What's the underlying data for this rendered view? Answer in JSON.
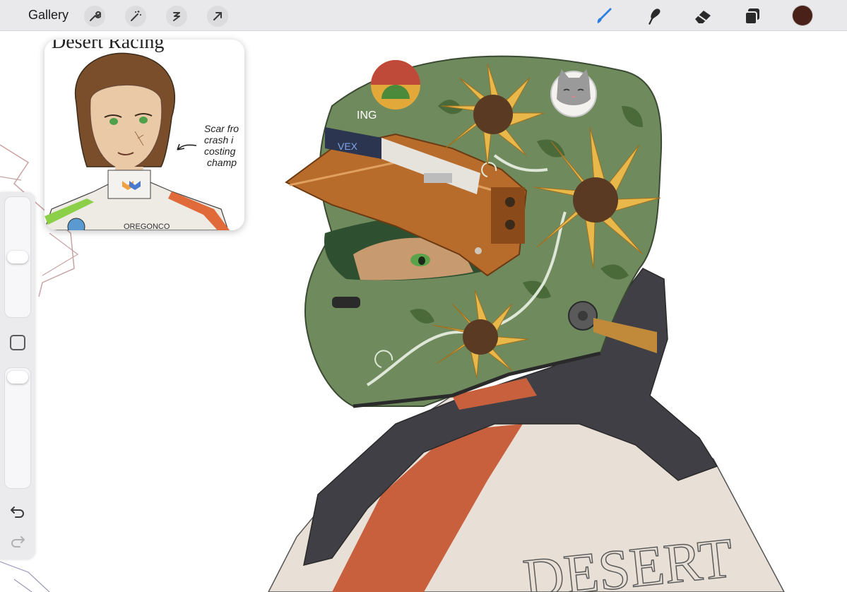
{
  "app": {
    "gallery_label": "Gallery",
    "left_tools": [
      "wrench-icon",
      "magic-wand-icon",
      "selection-icon",
      "transform-arrow-icon"
    ],
    "right_tools": [
      "brush-icon",
      "smudge-icon",
      "eraser-icon",
      "layers-icon",
      "color-icon"
    ],
    "active_color": "#4a2118",
    "accent_color": "#2f7fe0"
  },
  "reference": {
    "title": "Desert Racing",
    "note_lines": [
      "Scar fro",
      "crash i",
      "costing",
      "champ"
    ],
    "suit_text": "OREGONCO"
  },
  "canvas": {
    "helmet_visor_text": "VEX",
    "helmet_side_text": "ING",
    "suit_back_text": "DESERT"
  },
  "sidebar": {
    "undo_icon": "undo-icon",
    "redo_icon": "redo-icon"
  }
}
